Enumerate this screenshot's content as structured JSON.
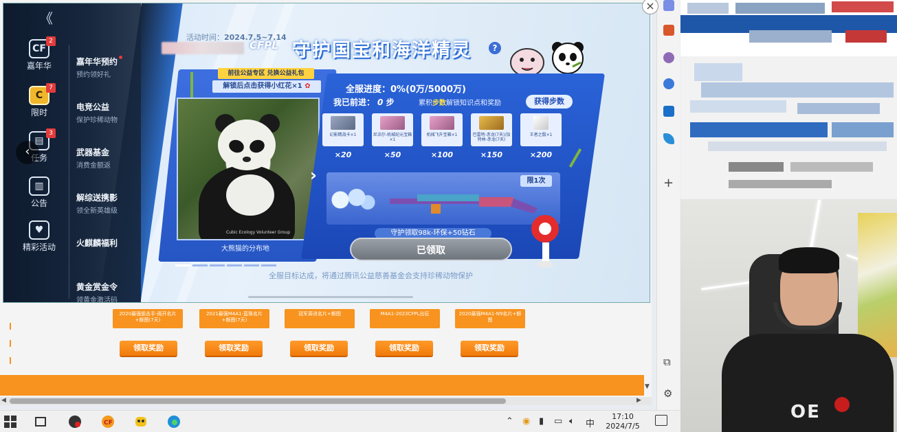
{
  "popup": {
    "close_label": "×",
    "collapse_label": "《",
    "back_label": "‹",
    "nav": {
      "icons": [
        {
          "label": "嘉年华",
          "glyph": "CF",
          "badge": "2"
        },
        {
          "label": "限时",
          "glyph": "C",
          "badge": "7"
        },
        {
          "label": "任务",
          "glyph": "▤",
          "badge": "3"
        },
        {
          "label": "公告",
          "glyph": "▥",
          "badge": ""
        },
        {
          "label": "精彩活动",
          "glyph": "♥",
          "badge": ""
        }
      ],
      "items": [
        {
          "title": "嘉年华预约",
          "sub": "预约领好礼"
        },
        {
          "title": "电竞公益",
          "sub": "保护珍稀动物"
        },
        {
          "title": "武器基金",
          "sub": "消费金额返"
        },
        {
          "title": "解综送携影",
          "sub": "领全新英雄级"
        },
        {
          "title": "火麒麟福利",
          "sub": ""
        },
        {
          "title": "黄金赏金令",
          "sub": "领黄金激活码"
        }
      ]
    },
    "header": {
      "cfpl": "CFPL",
      "title": "守护国宝和海洋精灵",
      "help": "?",
      "time_label": "活动时间：",
      "time_value": "2024.7.5~7.14"
    },
    "panda": {
      "tag1": "前往公益专区 兑换公益礼包",
      "tag2": "解锁后点击获得小红花×1",
      "tag2_flower": "✿",
      "credit": "Cubic Ecology Volunteer Group",
      "caption": "大熊猫的分布地"
    },
    "progress": {
      "server_progress": "全服进度：0%(0万/5000万)",
      "my_label": "我已前进：",
      "my_value": "0",
      "my_unit": "步",
      "hint_prefix": "累积",
      "hint_highlight": "步数",
      "hint_suffix": "解锁知识点和奖励",
      "get_steps_label": "获得步数",
      "rewards": [
        {
          "name": "幻影精战卡×1",
          "cost": "×20"
        },
        {
          "name": "尼泊尔-机械纪元宝箱×1",
          "cost": "×50"
        },
        {
          "name": "机械飞升宝箱×1",
          "cost": "×100"
        },
        {
          "name": "巴雷特-赤龙(7天)/加特林-赤龙(7天)",
          "cost": "×150"
        },
        {
          "name": "王者之骰×1",
          "cost": "×200"
        }
      ],
      "limit_label": "限1次",
      "guard_label": "守护领取98k-环保+50钻石",
      "claimed_label": "已领取",
      "footer": "全服目标达成，将通过腾讯公益慈善基金会支持珍稀动物保护"
    }
  },
  "background": {
    "cards": [
      {
        "text": "2020最强狙击手-雨开名片+额图(7天)",
        "claim": "领取奖励"
      },
      {
        "text": "2021最强M4A1-蓝珠名片+额图(7天)",
        "claim": "领取奖励"
      },
      {
        "text": "冠军周进名片+额图",
        "claim": "领取奖励"
      },
      {
        "text": "M4A1-2023CFPL出征",
        "claim": "领取奖励"
      },
      {
        "text": "2020最强M4A1-N9名片+额图",
        "claim": "领取奖励"
      }
    ]
  },
  "taskbar": {
    "time": "17:10",
    "date": "2024/7/5",
    "ime": "中"
  },
  "webcam": {
    "shirt_text": "OE"
  },
  "colors": {
    "accent_orange": "#f7931e",
    "popup_blue": "#2a63d8",
    "nav_dark": "#0e1b2e"
  }
}
